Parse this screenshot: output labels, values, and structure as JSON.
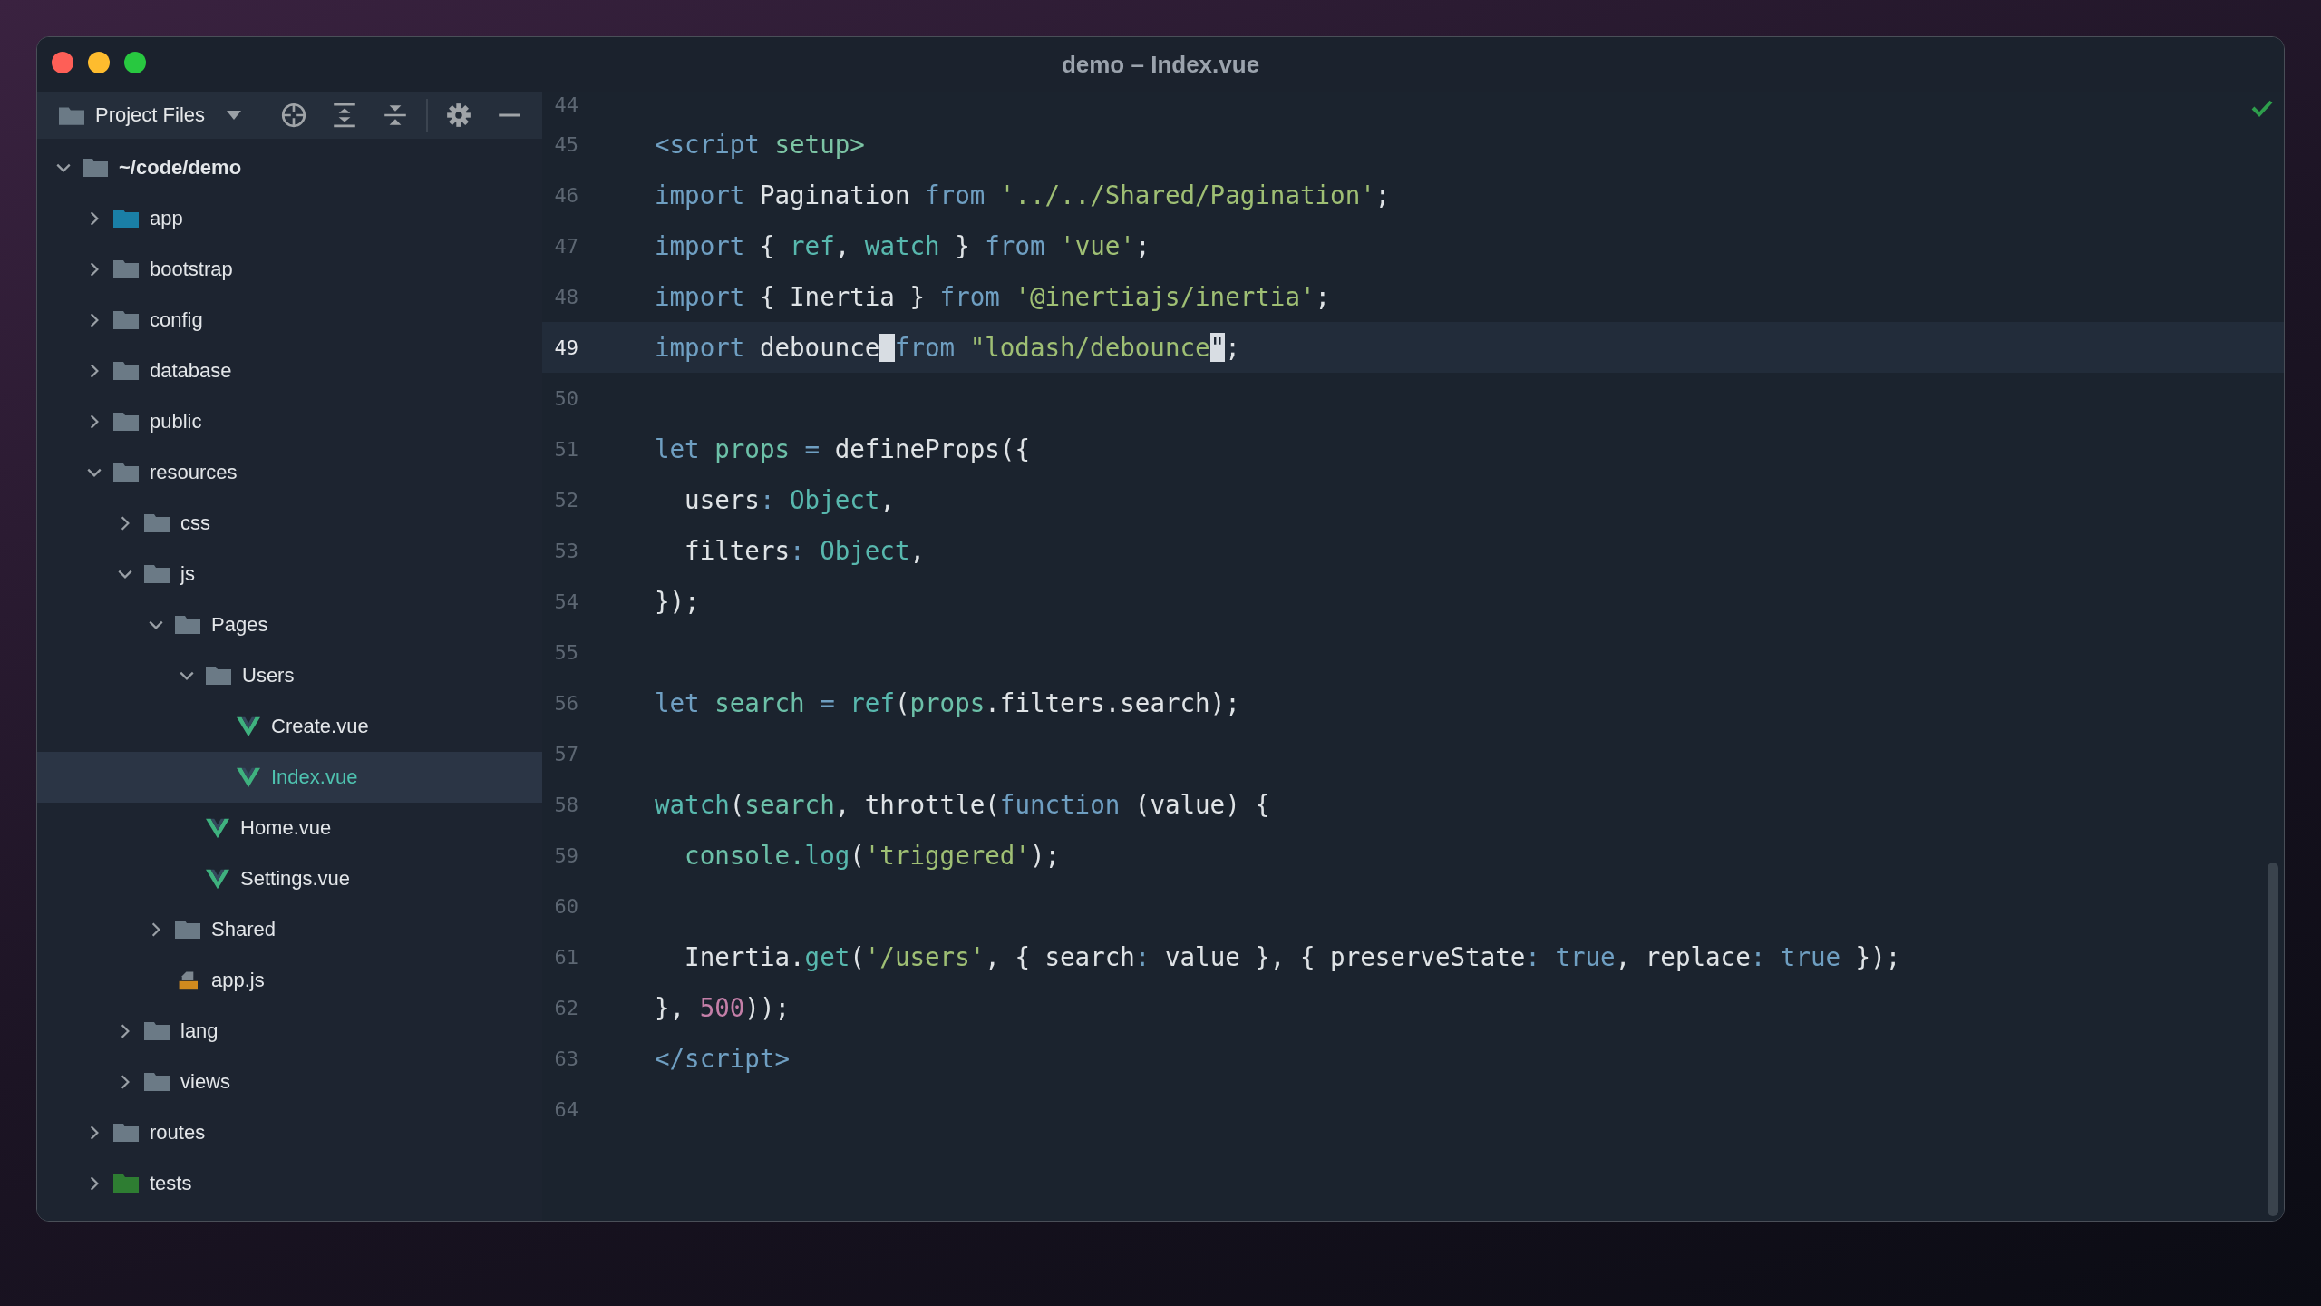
{
  "window": {
    "title": "demo – Index.vue"
  },
  "sidebar": {
    "header": {
      "label": "Project Files"
    },
    "tree": [
      {
        "name": "~/code/demo",
        "kind": "folder",
        "color": "#6b7a86",
        "expanded": true,
        "selected": false,
        "children": [
          {
            "name": "app",
            "kind": "folder",
            "color": "#1a7fa6",
            "expanded": false,
            "selected": false
          },
          {
            "name": "bootstrap",
            "kind": "folder",
            "color": "#6b7a86",
            "expanded": false,
            "selected": false
          },
          {
            "name": "config",
            "kind": "folder",
            "color": "#6b7a86",
            "expanded": false,
            "selected": false
          },
          {
            "name": "database",
            "kind": "folder",
            "color": "#6b7a86",
            "expanded": false,
            "selected": false
          },
          {
            "name": "public",
            "kind": "folder",
            "color": "#6b7a86",
            "expanded": false,
            "selected": false
          },
          {
            "name": "resources",
            "kind": "folder",
            "color": "#6b7a86",
            "expanded": true,
            "selected": false,
            "children": [
              {
                "name": "css",
                "kind": "folder",
                "color": "#6b7a86",
                "expanded": false,
                "selected": false
              },
              {
                "name": "js",
                "kind": "folder",
                "color": "#6b7a86",
                "expanded": true,
                "selected": false,
                "children": [
                  {
                    "name": "Pages",
                    "kind": "folder",
                    "color": "#6b7a86",
                    "expanded": true,
                    "selected": false,
                    "children": [
                      {
                        "name": "Users",
                        "kind": "folder",
                        "color": "#6b7a86",
                        "expanded": true,
                        "selected": false,
                        "children": [
                          {
                            "name": "Create.vue",
                            "kind": "vue",
                            "selected": false
                          },
                          {
                            "name": "Index.vue",
                            "kind": "vue",
                            "selected": true
                          }
                        ]
                      },
                      {
                        "name": "Home.vue",
                        "kind": "vue",
                        "selected": false
                      },
                      {
                        "name": "Settings.vue",
                        "kind": "vue",
                        "selected": false
                      }
                    ]
                  },
                  {
                    "name": "Shared",
                    "kind": "folder",
                    "color": "#6b7a86",
                    "expanded": false,
                    "selected": false
                  },
                  {
                    "name": "app.js",
                    "kind": "js",
                    "selected": false
                  }
                ]
              },
              {
                "name": "lang",
                "kind": "folder",
                "color": "#6b7a86",
                "expanded": false,
                "selected": false
              },
              {
                "name": "views",
                "kind": "folder",
                "color": "#6b7a86",
                "expanded": false,
                "selected": false
              }
            ]
          },
          {
            "name": "routes",
            "kind": "folder",
            "color": "#6b7a86",
            "expanded": false,
            "selected": false
          },
          {
            "name": "tests",
            "kind": "folder",
            "color": "#2e7d32",
            "expanded": false,
            "selected": false
          }
        ]
      }
    ]
  },
  "editor": {
    "lines": [
      {
        "number": "44",
        "current": false
      },
      {
        "number": "45",
        "current": false,
        "tokens": [
          {
            "text": "<script",
            "color": "#6f9fc2"
          },
          {
            "text": " setup>",
            "color": "#7cc4a4"
          }
        ]
      },
      {
        "number": "46",
        "current": false,
        "tokens": [
          {
            "text": "import ",
            "color": "#6f9fc2"
          },
          {
            "text": "Pagination ",
            "color": "#dfe3e6"
          },
          {
            "text": "from ",
            "color": "#6f9fc2"
          },
          {
            "text": "'../../Shared/Pagination'",
            "color": "#9fbf74"
          },
          {
            "text": ";",
            "color": "#dfe3e6"
          }
        ]
      },
      {
        "number": "47",
        "current": false,
        "tokens": [
          {
            "text": "import ",
            "color": "#6f9fc2"
          },
          {
            "text": "{ ",
            "color": "#dfe3e6"
          },
          {
            "text": "ref",
            "color": "#58b8ae"
          },
          {
            "text": ", ",
            "color": "#dfe3e6"
          },
          {
            "text": "watch",
            "color": "#58b8ae"
          },
          {
            "text": " } ",
            "color": "#dfe3e6"
          },
          {
            "text": "from ",
            "color": "#6f9fc2"
          },
          {
            "text": "'vue'",
            "color": "#9fbf74"
          },
          {
            "text": ";",
            "color": "#dfe3e6"
          }
        ]
      },
      {
        "number": "48",
        "current": false,
        "tokens": [
          {
            "text": "import ",
            "color": "#6f9fc2"
          },
          {
            "text": "{ Inertia } ",
            "color": "#dfe3e6"
          },
          {
            "text": "from ",
            "color": "#6f9fc2"
          },
          {
            "text": "'@inertiajs/inertia'",
            "color": "#9fbf74"
          },
          {
            "text": ";",
            "color": "#dfe3e6"
          }
        ]
      },
      {
        "number": "49",
        "current": true,
        "tokens": [
          {
            "text": "import ",
            "color": "#6f9fc2",
            "cursor_after": false,
            "selected": false
          },
          {
            "text": "debounce",
            "color": "#dfe3e6",
            "cursor_after": true,
            "selected": false
          },
          {
            "text": "from ",
            "color": "#6f9fc2",
            "cursor_after": false,
            "selected": false
          },
          {
            "text": "\"lodash/debounce",
            "color": "#9fbf74",
            "cursor_after": false,
            "selected": false
          },
          {
            "text": "\"",
            "color": "#1b2430",
            "cursor_after": false,
            "selected": true
          },
          {
            "text": ";",
            "color": "#dfe3e6",
            "cursor_after": false,
            "selected": false
          }
        ]
      },
      {
        "number": "50",
        "current": false
      },
      {
        "number": "51",
        "current": false,
        "tokens": [
          {
            "text": "let ",
            "color": "#6f9fc2"
          },
          {
            "text": "props ",
            "color": "#6cc0a8"
          },
          {
            "text": "= ",
            "color": "#6f9fc2"
          },
          {
            "text": "defineProps({",
            "color": "#dfe3e6"
          }
        ]
      },
      {
        "number": "52",
        "current": false,
        "tokens": [
          {
            "text": "  users",
            "color": "#dfe3e6"
          },
          {
            "text": ": ",
            "color": "#6f9fc2"
          },
          {
            "text": "Object",
            "color": "#58b8ae"
          },
          {
            "text": ",",
            "color": "#dfe3e6"
          }
        ]
      },
      {
        "number": "53",
        "current": false,
        "tokens": [
          {
            "text": "  filters",
            "color": "#dfe3e6"
          },
          {
            "text": ": ",
            "color": "#6f9fc2"
          },
          {
            "text": "Object",
            "color": "#58b8ae"
          },
          {
            "text": ",",
            "color": "#dfe3e6"
          }
        ]
      },
      {
        "number": "54",
        "current": false,
        "tokens": [
          {
            "text": "});",
            "color": "#dfe3e6"
          }
        ]
      },
      {
        "number": "55",
        "current": false
      },
      {
        "number": "56",
        "current": false,
        "tokens": [
          {
            "text": "let ",
            "color": "#6f9fc2"
          },
          {
            "text": "search ",
            "color": "#6cc0a8"
          },
          {
            "text": "= ",
            "color": "#6f9fc2"
          },
          {
            "text": "ref",
            "color": "#58b8ae"
          },
          {
            "text": "(",
            "color": "#dfe3e6"
          },
          {
            "text": "props",
            "color": "#6cc0a8"
          },
          {
            "text": ".filters.search);",
            "color": "#dfe3e6"
          }
        ]
      },
      {
        "number": "57",
        "current": false
      },
      {
        "number": "58",
        "current": false,
        "tokens": [
          {
            "text": "watch",
            "color": "#58b8ae"
          },
          {
            "text": "(",
            "color": "#dfe3e6"
          },
          {
            "text": "search",
            "color": "#6cc0a8"
          },
          {
            "text": ", throttle(",
            "color": "#dfe3e6"
          },
          {
            "text": "function",
            "color": "#6f9fc2"
          },
          {
            "text": " (value) {",
            "color": "#dfe3e6"
          }
        ]
      },
      {
        "number": "59",
        "current": false,
        "tokens": [
          {
            "text": "  console.",
            "color": "#6cc0a8"
          },
          {
            "text": "log",
            "color": "#58b8ae"
          },
          {
            "text": "(",
            "color": "#dfe3e6"
          },
          {
            "text": "'triggered'",
            "color": "#9fbf74"
          },
          {
            "text": ");",
            "color": "#dfe3e6"
          }
        ]
      },
      {
        "number": "60",
        "current": false
      },
      {
        "number": "61",
        "current": false,
        "tokens": [
          {
            "text": "  Inertia.",
            "color": "#dfe3e6"
          },
          {
            "text": "get",
            "color": "#58b8ae"
          },
          {
            "text": "(",
            "color": "#dfe3e6"
          },
          {
            "text": "'/users'",
            "color": "#9fbf74"
          },
          {
            "text": ", { search",
            "color": "#dfe3e6"
          },
          {
            "text": ": ",
            "color": "#6f9fc2"
          },
          {
            "text": "value }, { preserveState",
            "color": "#dfe3e6"
          },
          {
            "text": ": ",
            "color": "#6f9fc2"
          },
          {
            "text": "true",
            "color": "#6f9fc2"
          },
          {
            "text": ", replace",
            "color": "#dfe3e6"
          },
          {
            "text": ": ",
            "color": "#6f9fc2"
          },
          {
            "text": "true",
            "color": "#6f9fc2"
          },
          {
            "text": " });",
            "color": "#dfe3e6"
          }
        ]
      },
      {
        "number": "62",
        "current": false,
        "tokens": [
          {
            "text": "}, ",
            "color": "#dfe3e6"
          },
          {
            "text": "500",
            "color": "#c47fa8"
          },
          {
            "text": "));",
            "color": "#dfe3e6"
          }
        ]
      },
      {
        "number": "63",
        "current": false,
        "tokens": [
          {
            "text": "</script>",
            "color": "#6f9fc2"
          }
        ]
      },
      {
        "number": "64",
        "current": false
      }
    ]
  }
}
